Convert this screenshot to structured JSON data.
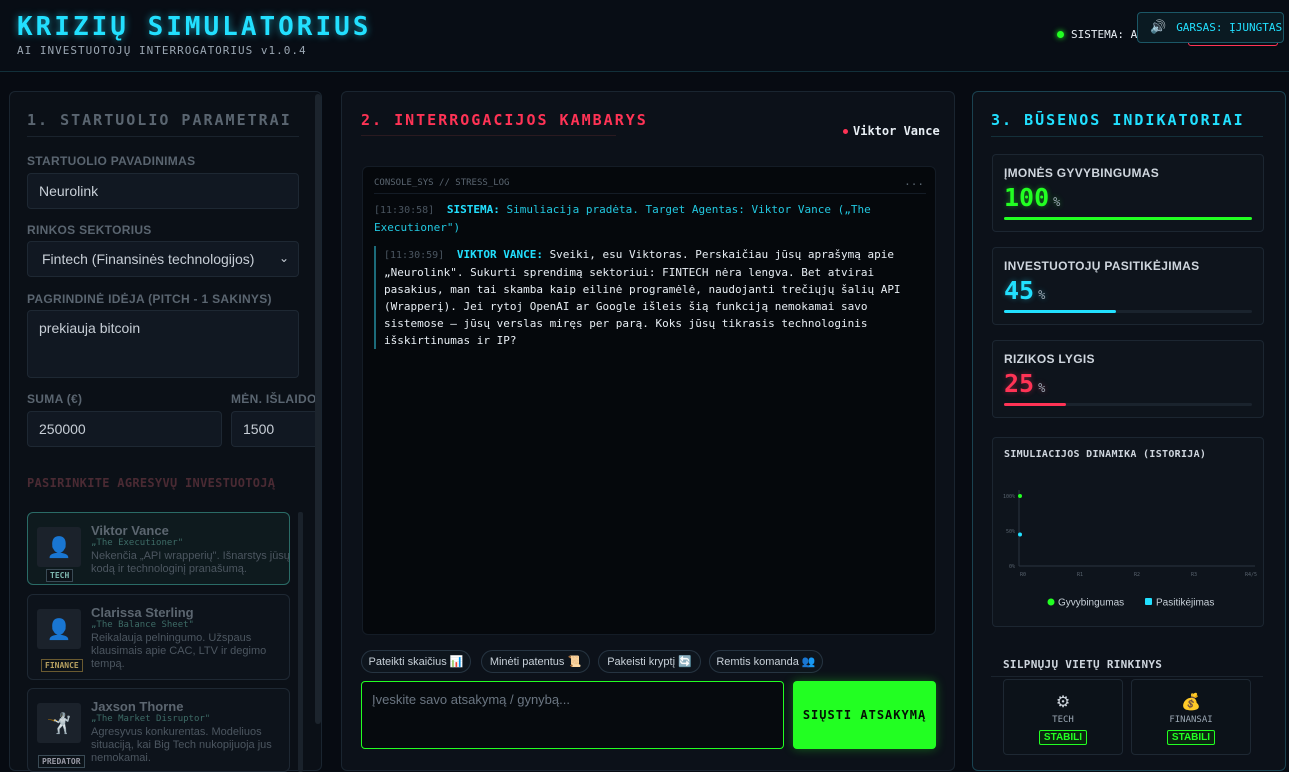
{
  "app": {
    "title": "KRIZIŲ SIMULATORIUS",
    "subtitle": "AI INVESTUOTOJŲ INTERROGATORIUS v1.0.4",
    "system_status": "SISTEMA: AKTYVI",
    "sound_label": "GARSAS: ĮJUNGTAS",
    "sound_icon": "speaker-icon"
  },
  "params": {
    "heading": "1. STARTUOLIO PARAMETRAI",
    "name_label": "STARTUOLIO PAVADINIMAS",
    "name_value": "Neurolink",
    "sector_label": "RINKOS SEKTORIUS",
    "sector_value": "Fintech (Finansinės technologijos)",
    "idea_label": "PAGRINDINĖ IDĖJA (PITCH - 1 SAKINYS)",
    "idea_value": "prekiauja bitcoin",
    "amount_label": "SUMA (€)",
    "amount_value": "250000",
    "expenses_label": "MĖN. IŠLAIDOS",
    "expenses_value": "1500",
    "investor_heading": "PASIRINKITE AGRESYVŲ INVESTUOTOJĄ",
    "investors": [
      {
        "name": "Viktor Vance",
        "nick": "„The Executioner\"",
        "desc": "Nekenčia „API wrapperių\". Išnarstys jūsų kodą ir technologinį pranašumą.",
        "tag": "TECH"
      },
      {
        "name": "Clarissa Sterling",
        "nick": "„The Balance Sheet\"",
        "desc": "Reikalauja pelningumo. Užspaus klausimais apie CAC, LTV ir degimo tempą.",
        "tag": "FINANCE"
      },
      {
        "name": "Jaxson Thorne",
        "nick": "„The Market Disruptor\"",
        "desc": "Agresyvus konkurentas. Modeliuos situaciją, kai Big Tech nukopijuoja jus nemokamai.",
        "tag": "PREDATOR"
      }
    ]
  },
  "room": {
    "heading": "2. INTERROGACIJOS KAMBARYS",
    "active_agent": "Viktor Vance",
    "console_label": "CONSOLE_SYS // STRESS_LOG",
    "console_menu": "...",
    "log": [
      {
        "time": "[11:30:58]",
        "speaker": "SISTEMA:",
        "text": "Simuliacija pradėta. Target Agentas: Viktor Vance („The Executioner\")"
      },
      {
        "time": "[11:30:59]",
        "speaker": "VIKTOR VANCE:",
        "text": "Sveiki, esu Viktoras. Perskaičiau jūsų aprašymą apie „Neurolink\". Sukurti sprendimą sektoriui: FINTECH nėra lengva. Bet atvirai pasakius, man tai skamba kaip eilinė programėlė, naudojanti trečiųjų šalių API (Wrapperį). Jei rytoj OpenAI ar Google išleis šią funkciją nemokamai savo sistemose – jūsų verslas miręs per parą. Koks jūsų tikrasis technologinis išskirtinumas ir IP?"
      }
    ],
    "chips": [
      "Pateikti skaičius 📊",
      "Minėti patentus 📜",
      "Pakeisti kryptį 🔄",
      "Remtis komanda 👥"
    ],
    "answer_placeholder": "Įveskite savo atsakymą / gynybą...",
    "send_label": "SIŲSTI ATSAKYMĄ"
  },
  "status": {
    "heading": "3. BŪSENOS INDIKATORIAI",
    "viability": {
      "label": "ĮMONĖS GYVYBINGUMAS",
      "value": "100",
      "unit": "%",
      "level": 100,
      "color": "#22ff22"
    },
    "confidence": {
      "label": "INVESTUOTOJŲ PASITIKĖJIMAS",
      "value": "45",
      "unit": "%",
      "level": 45,
      "color": "#22e0ff"
    },
    "risk": {
      "label": "RIZIKOS LYGIS",
      "value": "25",
      "unit": "%",
      "level": 25,
      "color": "#ff3355"
    },
    "weak_heading": "SILPNŲJŲ VIETŲ RINKINYS",
    "weak": [
      {
        "icon": "gear-icon",
        "label": "TECH",
        "status": "STABILI"
      },
      {
        "icon": "money-bag-icon",
        "label": "FINANSAI",
        "status": "STABILI"
      }
    ]
  },
  "chart_data": {
    "type": "line",
    "title": "SIMULIACIJOS DINAMIKA (ISTORIJA)",
    "x": [
      "R0",
      "R1",
      "R2",
      "R3",
      "R4/5"
    ],
    "y_ticks": [
      "100%",
      "50%",
      "0%"
    ],
    "ylim": [
      0,
      100
    ],
    "series": [
      {
        "name": "Gyvybingumas",
        "color": "#22ff22",
        "values": [
          100
        ]
      },
      {
        "name": "Pasitikėjimas",
        "color": "#22e0ff",
        "values": [
          45
        ]
      }
    ],
    "legend": "bottom"
  }
}
